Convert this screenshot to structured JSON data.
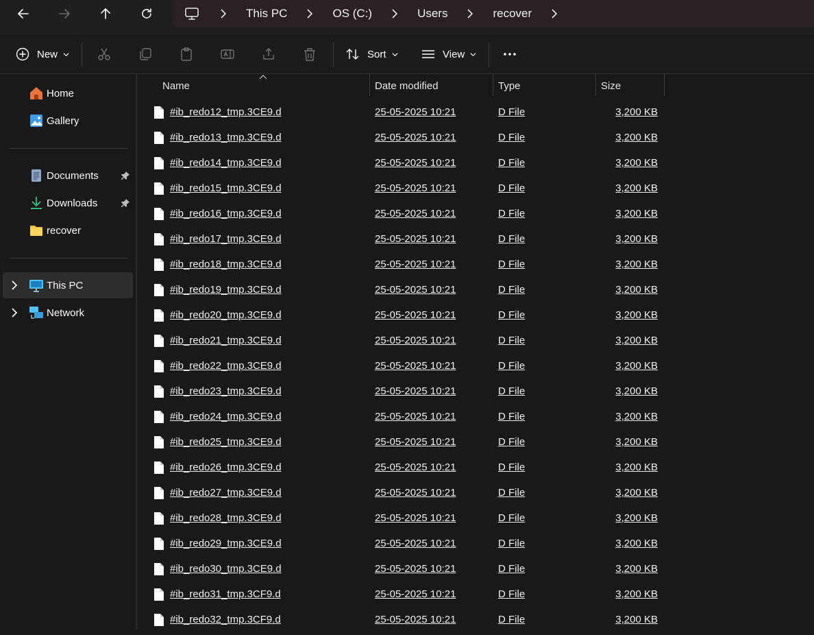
{
  "breadcrumbs": [
    "This PC",
    "OS (C:)",
    "Users",
    "recover"
  ],
  "toolbar": {
    "new_label": "New",
    "sort_label": "Sort",
    "view_label": "View"
  },
  "sidebar": {
    "items": [
      {
        "label": "Home",
        "icon": "home-icon"
      },
      {
        "label": "Gallery",
        "icon": "gallery-icon"
      },
      {
        "label": "Documents",
        "icon": "documents-icon",
        "pinned": true
      },
      {
        "label": "Downloads",
        "icon": "downloads-icon",
        "pinned": true
      },
      {
        "label": "recover",
        "icon": "folder-icon"
      },
      {
        "label": "This PC",
        "icon": "computer-icon",
        "selected": true
      },
      {
        "label": "Network",
        "icon": "network-icon"
      }
    ]
  },
  "columns": [
    "Name",
    "Date modified",
    "Type",
    "Size"
  ],
  "files": [
    {
      "name": "#ib_redo12_tmp.3CE9.d",
      "date": "25-05-2025 10:21",
      "type": "D File",
      "size": "3,200 KB"
    },
    {
      "name": "#ib_redo13_tmp.3CE9.d",
      "date": "25-05-2025 10:21",
      "type": "D File",
      "size": "3,200 KB"
    },
    {
      "name": "#ib_redo14_tmp.3CE9.d",
      "date": "25-05-2025 10:21",
      "type": "D File",
      "size": "3,200 KB"
    },
    {
      "name": "#ib_redo15_tmp.3CE9.d",
      "date": "25-05-2025 10:21",
      "type": "D File",
      "size": "3,200 KB"
    },
    {
      "name": "#ib_redo16_tmp.3CE9.d",
      "date": "25-05-2025 10:21",
      "type": "D File",
      "size": "3,200 KB"
    },
    {
      "name": "#ib_redo17_tmp.3CE9.d",
      "date": "25-05-2025 10:21",
      "type": "D File",
      "size": "3,200 KB"
    },
    {
      "name": "#ib_redo18_tmp.3CE9.d",
      "date": "25-05-2025 10:21",
      "type": "D File",
      "size": "3,200 KB"
    },
    {
      "name": "#ib_redo19_tmp.3CE9.d",
      "date": "25-05-2025 10:21",
      "type": "D File",
      "size": "3,200 KB"
    },
    {
      "name": "#ib_redo20_tmp.3CE9.d",
      "date": "25-05-2025 10:21",
      "type": "D File",
      "size": "3,200 KB"
    },
    {
      "name": "#ib_redo21_tmp.3CE9.d",
      "date": "25-05-2025 10:21",
      "type": "D File",
      "size": "3,200 KB"
    },
    {
      "name": "#ib_redo22_tmp.3CE9.d",
      "date": "25-05-2025 10:21",
      "type": "D File",
      "size": "3,200 KB"
    },
    {
      "name": "#ib_redo23_tmp.3CE9.d",
      "date": "25-05-2025 10:21",
      "type": "D File",
      "size": "3,200 KB"
    },
    {
      "name": "#ib_redo24_tmp.3CE9.d",
      "date": "25-05-2025 10:21",
      "type": "D File",
      "size": "3,200 KB"
    },
    {
      "name": "#ib_redo25_tmp.3CE9.d",
      "date": "25-05-2025 10:21",
      "type": "D File",
      "size": "3,200 KB"
    },
    {
      "name": "#ib_redo26_tmp.3CE9.d",
      "date": "25-05-2025 10:21",
      "type": "D File",
      "size": "3,200 KB"
    },
    {
      "name": "#ib_redo27_tmp.3CE9.d",
      "date": "25-05-2025 10:21",
      "type": "D File",
      "size": "3,200 KB"
    },
    {
      "name": "#ib_redo28_tmp.3CE9.d",
      "date": "25-05-2025 10:21",
      "type": "D File",
      "size": "3,200 KB"
    },
    {
      "name": "#ib_redo29_tmp.3CE9.d",
      "date": "25-05-2025 10:21",
      "type": "D File",
      "size": "3,200 KB"
    },
    {
      "name": "#ib_redo30_tmp.3CE9.d",
      "date": "25-05-2025 10:21",
      "type": "D File",
      "size": "3,200 KB"
    },
    {
      "name": "#ib_redo31_tmp.3CF9.d",
      "date": "25-05-2025 10:21",
      "type": "D File",
      "size": "3,200 KB"
    },
    {
      "name": "#ib_redo32_tmp.3CF9.d",
      "date": "25-05-2025 10:21",
      "type": "D File",
      "size": "3,200 KB"
    }
  ],
  "colors": {
    "background": "#191919",
    "address_bar": "#2a2222",
    "selected_nav": "#2d2d2d",
    "accent_blue": "#4cc2ff",
    "folder_yellow": "#f8c642",
    "home_orange": "#e8743b"
  }
}
